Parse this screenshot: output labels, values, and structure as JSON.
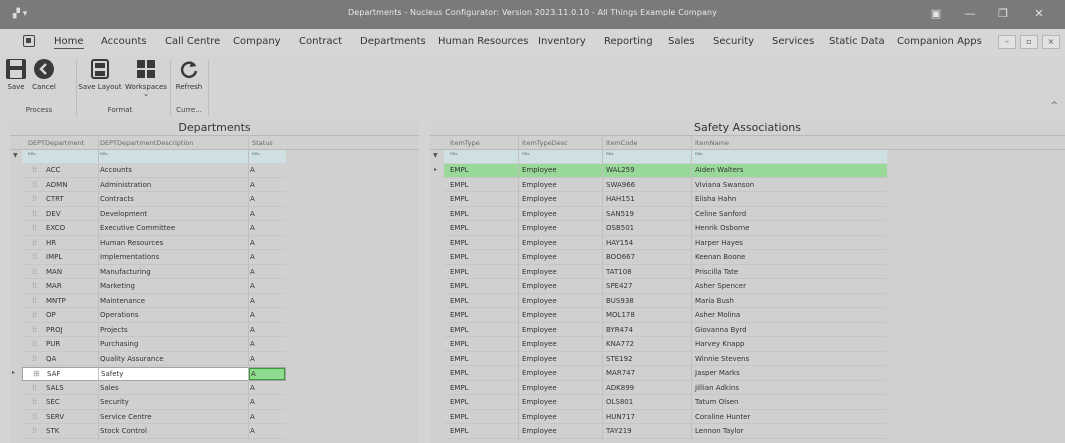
{
  "window": {
    "app_icon": "app-logo",
    "title": "Departments - Nucleus Configurator: Version 2023.11.0.10 - All Things Example Company",
    "controls": [
      "monitor-icon",
      "minimize-icon",
      "restore-icon",
      "close-icon"
    ]
  },
  "menu": {
    "tabs": [
      "Home",
      "Accounts",
      "Call Centre",
      "Company",
      "Contract",
      "Departments",
      "Human Resources",
      "Inventory",
      "Reporting",
      "Sales",
      "Security",
      "Services",
      "Static Data",
      "Companion Apps"
    ],
    "active_tab": "Home",
    "sub_controls": [
      "–",
      "▫",
      "×"
    ]
  },
  "ribbon": {
    "save": "Save",
    "cancel": "Cancel",
    "save_layout": "Save Layout",
    "workspaces": "Workspaces",
    "refresh": "Refresh",
    "groups": {
      "process": "Process",
      "format": "Format",
      "curre": "Curre..."
    }
  },
  "departments": {
    "title": "Departments",
    "columns": [
      "DEPTDepartment",
      "DEPTDepartmentDescription",
      "Status"
    ],
    "filter_cells": [
      "ᴿᴮᶜ",
      "ᴿᴮᶜ",
      "ᴿᴮᶜ"
    ],
    "rows": [
      [
        "ACC",
        "Accounts",
        "A"
      ],
      [
        "ADMN",
        "Administration",
        "A"
      ],
      [
        "CTRT",
        "Contracts",
        "A"
      ],
      [
        "DEV",
        "Development",
        "A"
      ],
      [
        "EXCO",
        "Executive Committee",
        "A"
      ],
      [
        "HR",
        "Human Resources",
        "A"
      ],
      [
        "IMPL",
        "Implementations",
        "A"
      ],
      [
        "MAN",
        "Manufacturing",
        "A"
      ],
      [
        "MAR",
        "Marketing",
        "A"
      ],
      [
        "MNTP",
        "Maintenance",
        "A"
      ],
      [
        "OP",
        "Operations",
        "A"
      ],
      [
        "PROJ",
        "Projects",
        "A"
      ],
      [
        "PUR",
        "Purchasing",
        "A"
      ],
      [
        "QA",
        "Quality Assurance",
        "A"
      ],
      [
        "SAF",
        "Safety",
        "A"
      ],
      [
        "SALS",
        "Sales",
        "A"
      ],
      [
        "SEC",
        "Security",
        "A"
      ],
      [
        "SERV",
        "Service Centre",
        "A"
      ],
      [
        "STK",
        "Stock Control",
        "A"
      ]
    ]
  },
  "safety": {
    "title": "Safety Associations",
    "columns": [
      "ItemType",
      "ItemTypeDesc",
      "ItemCode",
      "ItemName"
    ],
    "filter_cells": [
      "ᴿᴮᶜ",
      "ᴿᴮᶜ",
      "ᴿᴮᶜ",
      "ᴿᴮᶜ"
    ],
    "rows": [
      [
        "EMPL",
        "Employee",
        "WAL259",
        "Aiden Walters"
      ],
      [
        "EMPL",
        "Employee",
        "SWA966",
        "Viviana Swanson"
      ],
      [
        "EMPL",
        "Employee",
        "HAH151",
        "Elisha Hahn"
      ],
      [
        "EMPL",
        "Employee",
        "SAN519",
        "Celine Sanford"
      ],
      [
        "EMPL",
        "Employee",
        "OSB501",
        "Henrik Osborne"
      ],
      [
        "EMPL",
        "Employee",
        "HAY154",
        "Harper Hayes"
      ],
      [
        "EMPL",
        "Employee",
        "BOO667",
        "Keenan Boone"
      ],
      [
        "EMPL",
        "Employee",
        "TAT108",
        "Priscilla Tate"
      ],
      [
        "EMPL",
        "Employee",
        "SPE427",
        "Asher Spencer"
      ],
      [
        "EMPL",
        "Employee",
        "BUS938",
        "Maria Bush"
      ],
      [
        "EMPL",
        "Employee",
        "MOL178",
        "Asher Molina"
      ],
      [
        "EMPL",
        "Employee",
        "BYR474",
        "Giovanna Byrd"
      ],
      [
        "EMPL",
        "Employee",
        "KNA772",
        "Harvey Knapp"
      ],
      [
        "EMPL",
        "Employee",
        "STE192",
        "Winnie Stevens"
      ],
      [
        "EMPL",
        "Employee",
        "MAR747",
        "Jasper Marks"
      ],
      [
        "EMPL",
        "Employee",
        "ADK899",
        "Jillian Adkins"
      ],
      [
        "EMPL",
        "Employee",
        "OLS801",
        "Tatum Olsen"
      ],
      [
        "EMPL",
        "Employee",
        "HUN717",
        "Coraline Hunter"
      ],
      [
        "EMPL",
        "Employee",
        "TAY219",
        "Lennon Taylor"
      ]
    ]
  },
  "colors": {
    "titlebar": "#7a7a7a",
    "selected_status": "#8fdb8f",
    "highlight_row": "#98d898",
    "filter_row": "#cfe0e3"
  }
}
